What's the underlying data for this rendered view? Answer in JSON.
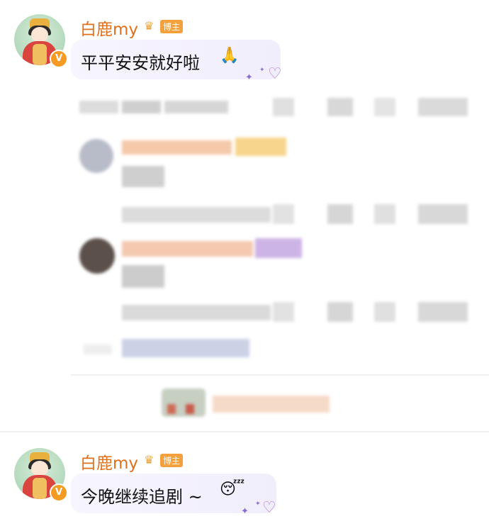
{
  "posts": [
    {
      "username": "白鹿my",
      "badge_label": "博主",
      "verified_mark": "V",
      "text": "平平安安就好啦",
      "emoji": "🙏"
    },
    {
      "username": "白鹿my",
      "badge_label": "博主",
      "verified_mark": "V",
      "text": "今晚继续追剧 ~",
      "emoji": "😴"
    }
  ],
  "icons": {
    "crown": "crown-icon",
    "heart": "heart-icon",
    "sparkle": "sparkle-icon"
  },
  "colors": {
    "username": "#e1701b",
    "badge": "#f3a13c",
    "bubble": "#f4f2fd"
  }
}
